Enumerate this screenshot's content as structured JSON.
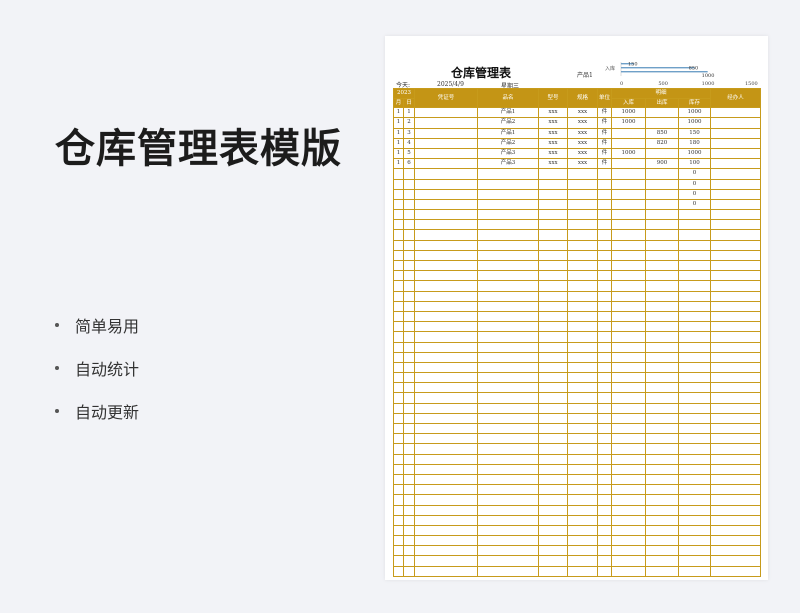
{
  "title": "仓库管理表模版",
  "features": [
    "简单易用",
    "自动统计",
    "自动更新"
  ],
  "sheet": {
    "title": "仓库管理表",
    "today_label": "今天:",
    "date": "2025/4/9",
    "weekday": "星期三",
    "product_label": "产品1",
    "chart": {
      "type": "bar",
      "series_label": "入库",
      "data_labels": [
        "150",
        "850",
        "1000"
      ],
      "ticks": [
        "0",
        "500",
        "1000",
        "1500"
      ]
    },
    "header": {
      "year": "2023",
      "month": "月",
      "day": "日",
      "voucher": "凭证号",
      "product": "品名",
      "model": "型号",
      "spec": "规格",
      "unit": "单位",
      "detail": "明细",
      "in": "入库",
      "out": "出库",
      "stock": "库存",
      "handler": "经办人"
    },
    "rows": [
      {
        "m": "1",
        "d": "1",
        "product": "产品1",
        "model": "xxx",
        "spec": "xxx",
        "unit": "件",
        "in": "1000",
        "out": "",
        "stock": "1000"
      },
      {
        "m": "1",
        "d": "2",
        "product": "产品2",
        "model": "xxx",
        "spec": "xxx",
        "unit": "件",
        "in": "1000",
        "out": "",
        "stock": "1000"
      },
      {
        "m": "1",
        "d": "3",
        "product": "产品1",
        "model": "xxx",
        "spec": "xxx",
        "unit": "件",
        "in": "",
        "out": "850",
        "stock": "150"
      },
      {
        "m": "1",
        "d": "4",
        "product": "产品2",
        "model": "xxx",
        "spec": "xxx",
        "unit": "件",
        "in": "",
        "out": "820",
        "stock": "180"
      },
      {
        "m": "1",
        "d": "5",
        "product": "产品3",
        "model": "xxx",
        "spec": "xxx",
        "unit": "件",
        "in": "1000",
        "out": "",
        "stock": "1000"
      },
      {
        "m": "1",
        "d": "6",
        "product": "产品3",
        "model": "xxx",
        "spec": "xxx",
        "unit": "件",
        "in": "",
        "out": "900",
        "stock": "100"
      },
      {
        "stock": "0"
      },
      {
        "stock": "0"
      },
      {
        "stock": "0"
      },
      {
        "stock": "0"
      }
    ],
    "empty_row_count": 36
  },
  "chart_data": {
    "type": "bar",
    "series": [
      {
        "name": "入库",
        "values": [
          150,
          850,
          1000
        ]
      }
    ],
    "data_labels": [
      "150",
      "850",
      "1000"
    ],
    "xlim": [
      0,
      1500
    ],
    "ticks": [
      0,
      500,
      1000,
      1500
    ],
    "orientation": "horizontal"
  }
}
